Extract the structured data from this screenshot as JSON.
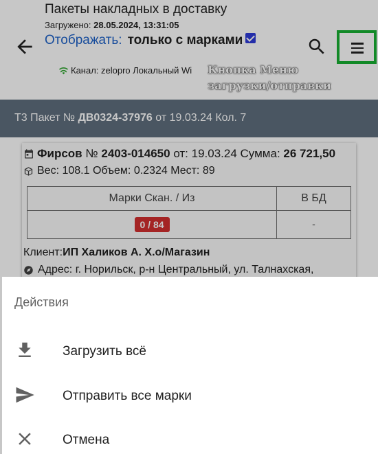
{
  "appbar": {
    "title": "Пакеты накладных в доставку",
    "loaded_label": "Загружено:",
    "loaded_value": "28.05.2024, 13:31:05",
    "filter_label": "Отображать:",
    "filter_value": "только с марками",
    "filter_checked": true,
    "channel_text": "Канал: zelopro Локальный Wi",
    "annotation_line1": "Кнопка Меню",
    "annotation_line2": "загрузки/отправки"
  },
  "icons": {
    "back": "arrow-back-icon",
    "search": "search-icon",
    "menu": "menu-icon",
    "wifi": "wifi-icon",
    "calendar": "calendar-icon",
    "box": "box-icon",
    "location": "location-icon",
    "download": "download-icon",
    "send": "send-icon",
    "close": "close-icon"
  },
  "packet": {
    "prefix": "Т3 Пакет №",
    "number": "ДВ0324-37976",
    "rest": "от 19.03.24 Кол. 7"
  },
  "card": {
    "client_name": "Фирсов",
    "doc_prefix": "№",
    "doc_number": "2403-014650",
    "doc_date_label": "от: 19.03.24 Сумма:",
    "sum": "26 721,50",
    "weight_line": "Вес: 108.1 Объем: 0.2324 Мест: 89",
    "table": {
      "headers": [
        "Марки Скан. / Из",
        "В БД"
      ],
      "marks": "0 / 84",
      "db": "-"
    },
    "client_label": "Клиент:",
    "client_value": "ИП Халиков А. Х.о/Магазин",
    "address": "Адрес: г. Норильск, р-н Центральный, ул. Талнахская,"
  },
  "sheet": {
    "title": "Действия",
    "items": [
      {
        "label": "Загрузить всё",
        "icon": "download-icon"
      },
      {
        "label": "Отправить все марки",
        "icon": "send-icon"
      },
      {
        "label": "Отмена",
        "icon": "close-icon"
      }
    ]
  },
  "colors": {
    "accent_blue": "#1e62c8",
    "checkbox": "#2f3bd9",
    "highlight_green": "#18b033",
    "packet_bar": "#5f6f7e",
    "badge_red": "#d32f2f"
  }
}
